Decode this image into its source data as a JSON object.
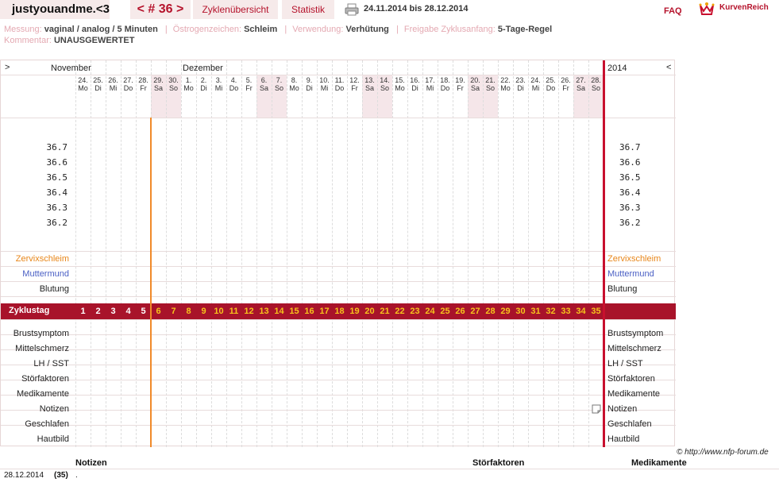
{
  "user": "justyouandme.<3",
  "nav": {
    "cycle": "< # 36 >",
    "overview": "Zyklenübersicht",
    "stats": "Statistik"
  },
  "period": "24.11.2014 bis 28.12.2014",
  "faq": "FAQ",
  "brand": "KurvenReich",
  "meta": {
    "measurement_label": "Messung:",
    "measurement": "vaginal / analog / 5 Minuten",
    "estrogen_label": "Östrogenzeichen:",
    "estrogen": "Schleim",
    "usage_label": "Verwendung:",
    "usage": "Verhütung",
    "release_label": "Freigabe Zyklusanfang:",
    "release": "5-Tage-Regel",
    "comment_label": "Kommentar:",
    "comment": "UNAUSGEWERTET"
  },
  "chart": {
    "left_arrow": ">",
    "right_arrow": "<",
    "months": [
      "November",
      "Dezember"
    ],
    "year": "2014",
    "days": [
      {
        "d": "24.",
        "w": "Mo"
      },
      {
        "d": "25.",
        "w": "Di"
      },
      {
        "d": "26.",
        "w": "Mi"
      },
      {
        "d": "27.",
        "w": "Do"
      },
      {
        "d": "28.",
        "w": "Fr"
      },
      {
        "d": "29.",
        "w": "Sa"
      },
      {
        "d": "30.",
        "w": "So"
      },
      {
        "d": "1.",
        "w": "Mo"
      },
      {
        "d": "2.",
        "w": "Di"
      },
      {
        "d": "3.",
        "w": "Mi"
      },
      {
        "d": "4.",
        "w": "Do"
      },
      {
        "d": "5.",
        "w": "Fr"
      },
      {
        "d": "6.",
        "w": "Sa"
      },
      {
        "d": "7.",
        "w": "So"
      },
      {
        "d": "8.",
        "w": "Mo"
      },
      {
        "d": "9.",
        "w": "Di"
      },
      {
        "d": "10.",
        "w": "Mi"
      },
      {
        "d": "11.",
        "w": "Do"
      },
      {
        "d": "12.",
        "w": "Fr"
      },
      {
        "d": "13.",
        "w": "Sa"
      },
      {
        "d": "14.",
        "w": "So"
      },
      {
        "d": "15.",
        "w": "Mo"
      },
      {
        "d": "16.",
        "w": "Di"
      },
      {
        "d": "17.",
        "w": "Mi"
      },
      {
        "d": "18.",
        "w": "Do"
      },
      {
        "d": "19.",
        "w": "Fr"
      },
      {
        "d": "20.",
        "w": "Sa"
      },
      {
        "d": "21.",
        "w": "So"
      },
      {
        "d": "22.",
        "w": "Mo"
      },
      {
        "d": "23.",
        "w": "Di"
      },
      {
        "d": "24.",
        "w": "Mi"
      },
      {
        "d": "25.",
        "w": "Do"
      },
      {
        "d": "26.",
        "w": "Fr"
      },
      {
        "d": "27.",
        "w": "Sa"
      },
      {
        "d": "28.",
        "w": "So"
      }
    ],
    "temperatures": [
      "36.7",
      "36.6",
      "36.5",
      "36.4",
      "36.3",
      "36.2"
    ],
    "rows_top": [
      {
        "label": "Zervixschleim",
        "color": "#e8861a"
      },
      {
        "label": "Muttermund",
        "color": "#4a5fc4"
      },
      {
        "label": "Blutung",
        "color": "#222222"
      }
    ],
    "cycle_label": "Zyklustag",
    "cycle_days": [
      "1",
      "2",
      "3",
      "4",
      "5",
      "6",
      "7",
      "8",
      "9",
      "10",
      "11",
      "12",
      "13",
      "14",
      "15",
      "16",
      "17",
      "18",
      "19",
      "20",
      "21",
      "22",
      "23",
      "24",
      "25",
      "26",
      "27",
      "28",
      "29",
      "30",
      "31",
      "32",
      "33",
      "34",
      "35"
    ],
    "rows_bottom": [
      "Brustsymptom",
      "Mittelschmerz",
      "LH / SST",
      "Störfaktoren",
      "Medikamente",
      "Notizen",
      "Geschlafen",
      "Hautbild"
    ],
    "colors": {
      "accent": "#a8132a",
      "weekend": "#f5e6e9",
      "cycle_start": "#f08a2a",
      "today": "#c8102e",
      "cycle_day_text": "#f6c21c"
    }
  },
  "copyright": "© http://www.nfp-forum.de",
  "bottom": {
    "headers": [
      "Notizen",
      "Störfaktoren",
      "Medikamente"
    ],
    "date": "28.12.2014",
    "day": "(35)",
    "note": "."
  }
}
